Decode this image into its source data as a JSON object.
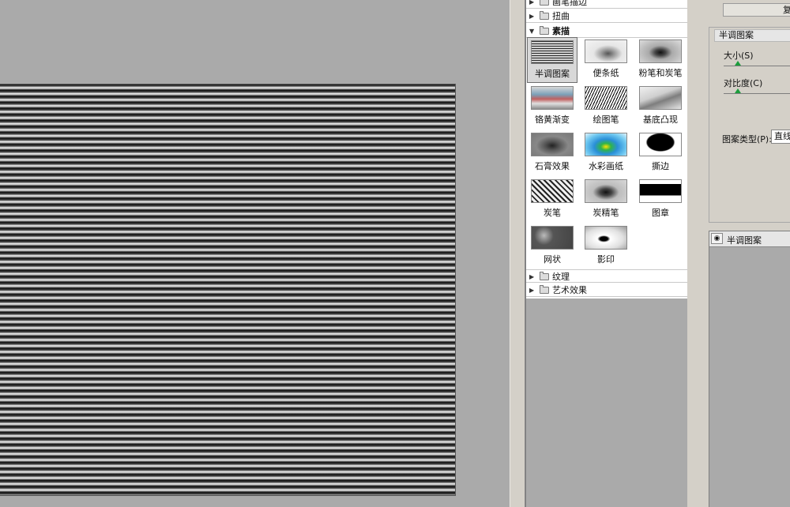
{
  "gallery": {
    "categories_top": [
      {
        "label": "画笔描边",
        "expanded": false
      },
      {
        "label": "扭曲",
        "expanded": false
      },
      {
        "label": "素描",
        "expanded": true
      }
    ],
    "sketch_filters": [
      {
        "label": "半调图案",
        "selected": true
      },
      {
        "label": "便条纸"
      },
      {
        "label": "粉笔和炭笔"
      },
      {
        "label": "铬黄渐变"
      },
      {
        "label": "绘图笔"
      },
      {
        "label": "基底凸现"
      },
      {
        "label": "石膏效果"
      },
      {
        "label": "水彩画纸"
      },
      {
        "label": "撕边"
      },
      {
        "label": "炭笔"
      },
      {
        "label": "炭精笔"
      },
      {
        "label": "图章"
      },
      {
        "label": "网状"
      },
      {
        "label": "影印"
      }
    ],
    "categories_bottom": [
      {
        "label": "纹理",
        "expanded": false
      },
      {
        "label": "艺术效果",
        "expanded": false
      }
    ]
  },
  "settings": {
    "top_button": "复",
    "filter_title": "半调图案",
    "size_label": "大小(S)",
    "size_value": 0.2,
    "contrast_label": "对比度(C)",
    "contrast_value": 0.2,
    "pattern_type_label": "图案类型(P):",
    "pattern_type_value": "直线"
  },
  "layers": {
    "items": [
      {
        "name": "半调图案",
        "visible": true
      }
    ]
  },
  "icons": {
    "expand": "triangle-right-icon",
    "collapse": "triangle-down-icon",
    "folder": "folder-icon",
    "eye": "eye-icon"
  },
  "colors": {
    "slider_thumb": "#1b9d3c",
    "panel_bg": "#d4d0c8",
    "workspace_bg": "#aaaaaa"
  }
}
